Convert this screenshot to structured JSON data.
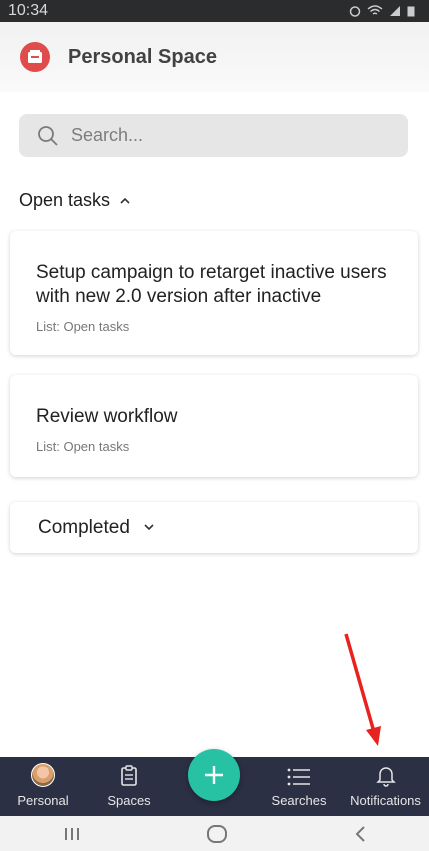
{
  "status_bar": {
    "time": "10:34"
  },
  "header": {
    "title": "Personal Space"
  },
  "search": {
    "placeholder": "Search..."
  },
  "open_tasks": {
    "title": "Open tasks",
    "tasks": [
      {
        "title": "Setup campaign to retarget inactive users with new 2.0 version after  inactive",
        "list": "List: Open tasks"
      },
      {
        "title": "Review workflow",
        "list": "List: Open tasks"
      }
    ]
  },
  "completed": {
    "label": "Completed"
  },
  "bottom_nav": {
    "items": [
      {
        "label": "Personal",
        "icon": "avatar"
      },
      {
        "label": "Spaces",
        "icon": "clipboard-icon"
      },
      {
        "label": "Searches",
        "icon": "list-icon"
      },
      {
        "label": "Notifications",
        "icon": "bell-icon"
      }
    ],
    "fab_icon": "plus-icon"
  },
  "colors": {
    "accent": "#26c2a3",
    "nav_bg": "#2b3044",
    "arrow": "#e8231f",
    "logo": "#e04b4b"
  }
}
